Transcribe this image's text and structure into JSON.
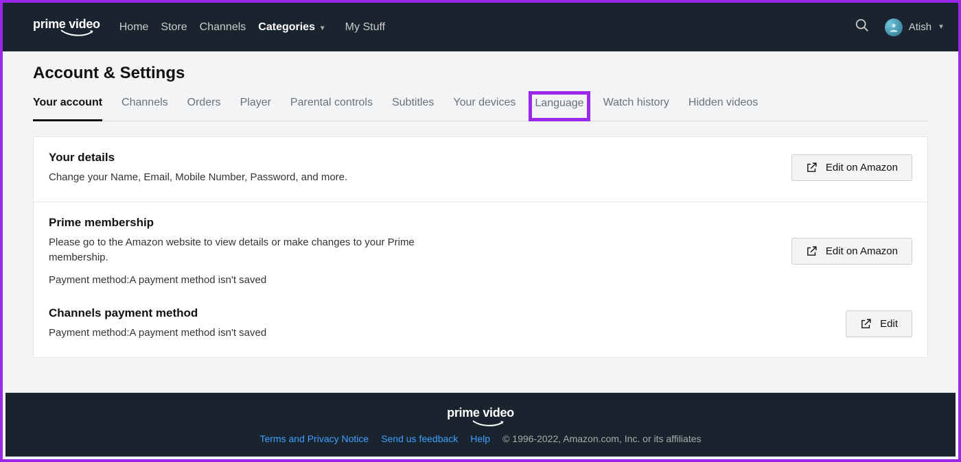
{
  "header": {
    "logo": "prime video",
    "nav": {
      "home": "Home",
      "store": "Store",
      "channels": "Channels",
      "categories": "Categories",
      "mystuff": "My Stuff"
    },
    "user": "Atish"
  },
  "page": {
    "title": "Account & Settings"
  },
  "tabs": {
    "your_account": "Your account",
    "channels": "Channels",
    "orders": "Orders",
    "player": "Player",
    "parental": "Parental controls",
    "subtitles": "Subtitles",
    "devices": "Your devices",
    "language": "Language",
    "history": "Watch history",
    "hidden": "Hidden videos"
  },
  "sections": {
    "details": {
      "title": "Your details",
      "desc": "Change your Name, Email, Mobile Number, Password, and more.",
      "button": "Edit on Amazon"
    },
    "prime": {
      "title": "Prime membership",
      "desc": "Please go to the Amazon website to view details or make changes to your Prime membership.",
      "payment": "Payment method:A payment method isn't saved",
      "button": "Edit on Amazon"
    },
    "channels_payment": {
      "title": "Channels payment method",
      "payment": "Payment method:A payment method isn't saved",
      "button": "Edit"
    }
  },
  "footer": {
    "logo": "prime video",
    "terms": "Terms and Privacy Notice",
    "feedback": "Send us feedback",
    "help": "Help",
    "copyright": "© 1996-2022, Amazon.com, Inc. or its affiliates"
  }
}
